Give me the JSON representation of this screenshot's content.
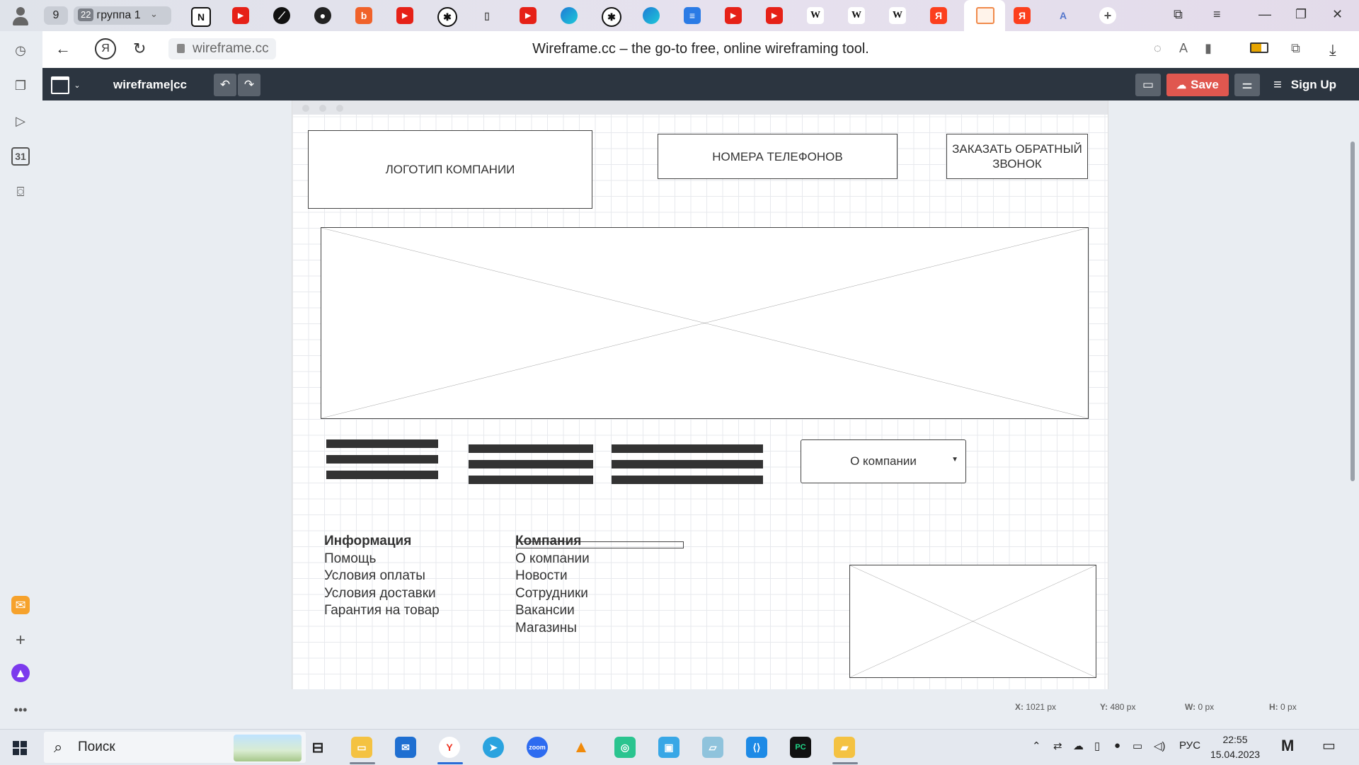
{
  "browser": {
    "tab_group_count": "9",
    "group_tab_count": "22",
    "group_label": "группа 1",
    "url": "wireframe.cc",
    "page_title": "Wireframe.cc – the go-to free, online wireframing tool."
  },
  "toolbar": {
    "logo": "wireframe|cc",
    "save_label": "Save",
    "signup_label": "Sign Up"
  },
  "wireframe": {
    "logo_box": "ЛОГОТИП КОМПАНИИ",
    "phones_box": "НОМЕРА ТЕЛЕФОНОВ",
    "callback_box": "ЗАКАЗАТЬ ОБРАТНЫЙ ЗВОНОК",
    "dropdown_value": "О компании",
    "info_column": {
      "heading": "Информация",
      "items": [
        "Помощь",
        "Условия оплаты",
        "Условия доставки",
        "Гарантия на товар"
      ]
    },
    "company_column": {
      "heading": "Компания",
      "items": [
        "О компании",
        "Новости",
        "Сотрудники",
        "Вакансии",
        "Магазины"
      ]
    }
  },
  "status_bar": {
    "x": "X:",
    "x_val": "1021 px",
    "y": "Y:",
    "y_val": "480 px",
    "w": "W:",
    "w_val": "0 px",
    "h": "H:",
    "h_val": "0 px"
  },
  "taskbar": {
    "search_label": "Поиск",
    "language": "РУС",
    "time": "22:55",
    "date": "15.04.2023"
  },
  "icons": {
    "tabs": [
      "notion-icon",
      "youtube-icon",
      "link-icon",
      "github-icon",
      "b-icon",
      "youtube-icon",
      "openai-icon",
      "file-icon",
      "youtube-icon",
      "edge-icon",
      "openai-icon",
      "edge-icon",
      "docs-icon",
      "youtube-icon",
      "youtube-icon",
      "wikipedia-icon",
      "wikipedia-icon",
      "wikipedia-icon",
      "yandex-icon",
      "wireframe-icon",
      "yandex-icon",
      "translate-icon"
    ]
  },
  "colors": {
    "app_toolbar": "#2c3540",
    "save_button": "#e0574f",
    "ink": "#444444"
  }
}
